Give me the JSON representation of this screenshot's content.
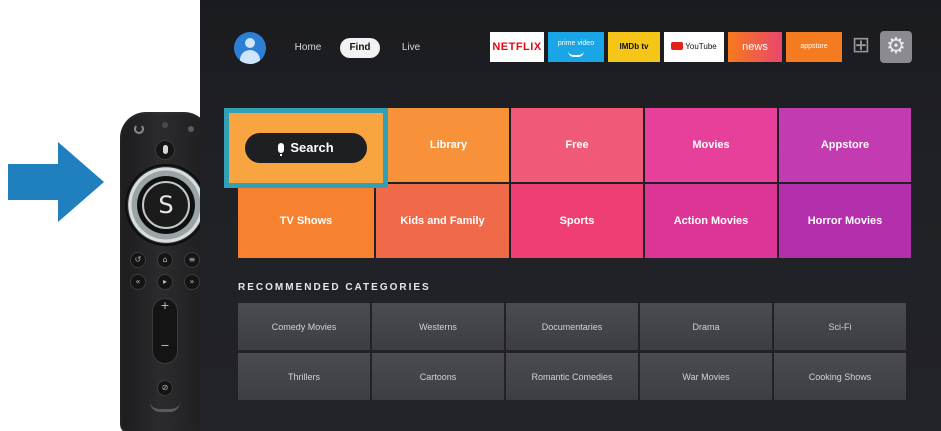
{
  "arrow": {
    "color": "#1f7fbf",
    "icon": "arrow-right-icon"
  },
  "remote": {
    "center_button_letter": "S",
    "icons": [
      "power-icon",
      "microphone-icon",
      "back-icon",
      "home-icon",
      "menu-icon",
      "rewind-icon",
      "play-pause-icon",
      "fast-forward-icon",
      "volume-up-icon",
      "volume-down-icon",
      "mute-icon"
    ],
    "glyphs": {
      "back": "↺",
      "home": "⌂",
      "menu": "≡",
      "rewind": "«",
      "play": "▸",
      "ffwd": "»",
      "vol_up": "+",
      "vol_down": "−",
      "mute": "⊘"
    }
  },
  "topbar": {
    "nav": [
      {
        "label": "Home"
      },
      {
        "label": "Find",
        "selected": true
      },
      {
        "label": "Live"
      }
    ],
    "apps": [
      {
        "label": "NETFLIX"
      },
      {
        "label": "prime video"
      },
      {
        "label": "IMDb tv"
      },
      {
        "label": "YouTube"
      },
      {
        "label": "news"
      },
      {
        "label": "appstore"
      }
    ],
    "grid_glyph": "⊞",
    "gear_glyph": "⚙"
  },
  "tiles": {
    "search_label": "Search",
    "row1": [
      {
        "label": "Library",
        "color": "#f7923a"
      },
      {
        "label": "Free",
        "color": "#f05a78"
      },
      {
        "label": "Movies",
        "color": "#e7409a"
      },
      {
        "label": "Appstore",
        "color": "#c23bb0"
      }
    ],
    "row2": [
      {
        "label": "TV Shows",
        "color": "#f6812f"
      },
      {
        "label": "Kids and Family",
        "color": "#f06a4a"
      },
      {
        "label": "Sports",
        "color": "#ef3e73"
      },
      {
        "label": "Action Movies",
        "color": "#dc3595"
      },
      {
        "label": "Horror Movies",
        "color": "#b42fab"
      }
    ]
  },
  "recommended": {
    "heading": "RECOMMENDED CATEGORIES",
    "row1": [
      "Comedy Movies",
      "Westerns",
      "Documentaries",
      "Drama",
      "Sci-Fi"
    ],
    "row2": [
      "Thrillers",
      "Cartoons",
      "Romantic Comedies",
      "War Movies",
      "Cooking Shows"
    ]
  }
}
